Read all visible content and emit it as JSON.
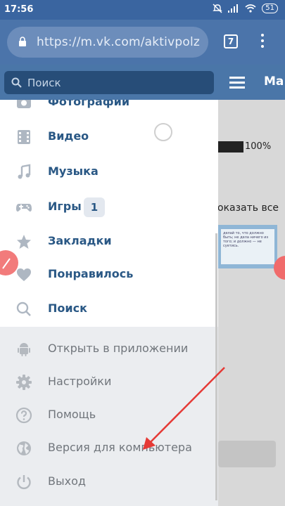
{
  "status_bar": {
    "time": "17:56",
    "battery": "51"
  },
  "browser": {
    "url": "https://m.vk.com/aktivpolz",
    "tab_count": "7"
  },
  "header": {
    "search_placeholder": "Поиск",
    "title": "Ма"
  },
  "menu": {
    "items": [
      {
        "label": "Фотографии",
        "icon": "photo-icon"
      },
      {
        "label": "Видео",
        "icon": "video-icon"
      },
      {
        "label": "Музыка",
        "icon": "music-icon"
      },
      {
        "label": "Игры",
        "icon": "gamepad-icon",
        "badge": "1"
      },
      {
        "label": "Закладки",
        "icon": "star-icon"
      },
      {
        "label": "Понравилось",
        "icon": "heart-icon"
      },
      {
        "label": "Поиск",
        "icon": "search-icon"
      }
    ],
    "secondary_items": [
      {
        "label": "Открыть в приложении",
        "icon": "android-icon"
      },
      {
        "label": "Настройки",
        "icon": "gear-icon"
      },
      {
        "label": "Помощь",
        "icon": "help-icon"
      },
      {
        "label": "Версия для компьютера",
        "icon": "globe-icon"
      },
      {
        "label": "Выход",
        "icon": "power-icon"
      }
    ]
  },
  "background_page": {
    "progress_text": "100%",
    "show_all": "оказать все",
    "quote_text": "делай то, что должно быть; не дела ничего из того; и должно — не суетись."
  },
  "colors": {
    "vk_blue": "#4a76a8",
    "link": "#2a5885",
    "muted": "#71767c",
    "arrow": "#e53935"
  }
}
